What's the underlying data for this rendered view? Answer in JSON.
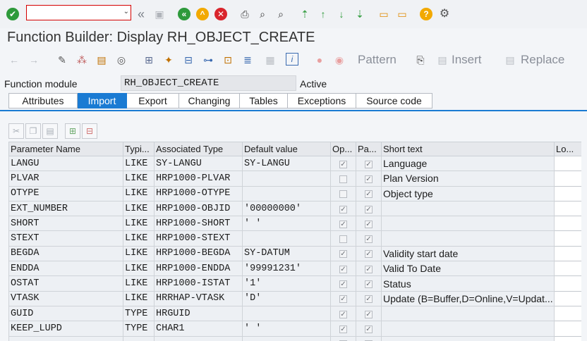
{
  "toolbar": {
    "command_field": {
      "value": "",
      "placeholder": ""
    },
    "icons": [
      "enter-icon",
      "back-icon",
      "save-icon",
      "back-green-icon",
      "exit-icon",
      "cancel-icon",
      "print-icon",
      "find-icon",
      "find-next-icon",
      "first-page-icon",
      "prev-page-icon",
      "next-page-icon",
      "last-page-icon",
      "new-session-icon",
      "shortcut-icon",
      "help-icon",
      "settings-icon"
    ]
  },
  "title": "Function Builder: Display RH_OBJECT_CREATE",
  "app_toolbar": {
    "pattern_label": "Pattern",
    "insert_label": "Insert",
    "replace_label": "Replace"
  },
  "function_module": {
    "label": "Function module",
    "value": "RH_OBJECT_CREATE",
    "status": "Active"
  },
  "tabs": [
    {
      "label": "Attributes",
      "active": false
    },
    {
      "label": "Import",
      "active": true
    },
    {
      "label": "Export",
      "active": false
    },
    {
      "label": "Changing",
      "active": false
    },
    {
      "label": "Tables",
      "active": false
    },
    {
      "label": "Exceptions",
      "active": false
    },
    {
      "label": "Source code",
      "active": false
    }
  ],
  "columns": [
    "Parameter Name",
    "Typi...",
    "Associated Type",
    "Default value",
    "Op...",
    "Pa...",
    "Short text",
    "Lo..."
  ],
  "rows": [
    {
      "name": "LANGU",
      "typing": "LIKE",
      "assoc": "SY-LANGU",
      "default": "SY-LANGU",
      "optional": true,
      "pass_value": true,
      "short_text": "Language"
    },
    {
      "name": "PLVAR",
      "typing": "LIKE",
      "assoc": "HRP1000-PLVAR",
      "default": "",
      "optional": false,
      "pass_value": true,
      "short_text": "Plan Version"
    },
    {
      "name": "OTYPE",
      "typing": "LIKE",
      "assoc": "HRP1000-OTYPE",
      "default": "",
      "optional": false,
      "pass_value": true,
      "short_text": "Object type"
    },
    {
      "name": "EXT_NUMBER",
      "typing": "LIKE",
      "assoc": "HRP1000-OBJID",
      "default": "'00000000'",
      "optional": true,
      "pass_value": true,
      "short_text": ""
    },
    {
      "name": "SHORT",
      "typing": "LIKE",
      "assoc": "HRP1000-SHORT",
      "default": "' '",
      "optional": true,
      "pass_value": true,
      "short_text": ""
    },
    {
      "name": "STEXT",
      "typing": "LIKE",
      "assoc": "HRP1000-STEXT",
      "default": "",
      "optional": false,
      "pass_value": true,
      "short_text": ""
    },
    {
      "name": "BEGDA",
      "typing": "LIKE",
      "assoc": "HRP1000-BEGDA",
      "default": "SY-DATUM",
      "optional": true,
      "pass_value": true,
      "short_text": "Validity start date"
    },
    {
      "name": "ENDDA",
      "typing": "LIKE",
      "assoc": "HRP1000-ENDDA",
      "default": "'99991231'",
      "optional": true,
      "pass_value": true,
      "short_text": "Valid To Date"
    },
    {
      "name": "OSTAT",
      "typing": "LIKE",
      "assoc": "HRP1000-ISTAT",
      "default": "'1'",
      "optional": true,
      "pass_value": true,
      "short_text": "Status"
    },
    {
      "name": "VTASK",
      "typing": "LIKE",
      "assoc": "HRRHAP-VTASK",
      "default": "'D'",
      "optional": true,
      "pass_value": true,
      "short_text": "Update (B=Buffer,D=Online,V=Updat..."
    },
    {
      "name": "GUID",
      "typing": "TYPE",
      "assoc": "HRGUID",
      "default": "",
      "optional": true,
      "pass_value": true,
      "short_text": ""
    },
    {
      "name": "KEEP_LUPD",
      "typing": "TYPE",
      "assoc": "CHAR1",
      "default": "' '",
      "optional": true,
      "pass_value": true,
      "short_text": ""
    },
    {
      "name": "",
      "typing": "",
      "assoc": "",
      "default": "",
      "optional": false,
      "pass_value": false,
      "short_text": ""
    }
  ]
}
